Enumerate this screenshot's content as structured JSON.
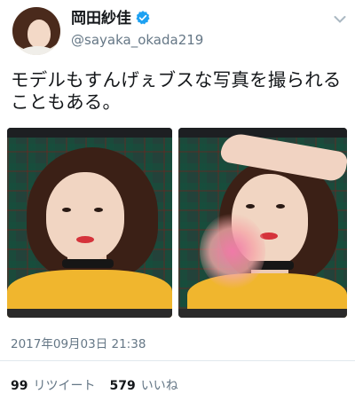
{
  "tweet": {
    "author_name": "岡田紗佳",
    "handle": "@sayaka_okada219",
    "text": "モデルもすんげぇブスな写真を撮られることもある。",
    "timestamp": "2017年09月03日 21:38"
  },
  "stats": {
    "retweets_count": "99",
    "retweets_label": "リツイート",
    "likes_count": "579",
    "likes_label": "いいね"
  },
  "colors": {
    "verified_blue": "#1da1f2",
    "secondary_text": "#657786"
  },
  "icons": {
    "verified": "verified-badge-icon",
    "menu": "chevron-down-icon"
  }
}
